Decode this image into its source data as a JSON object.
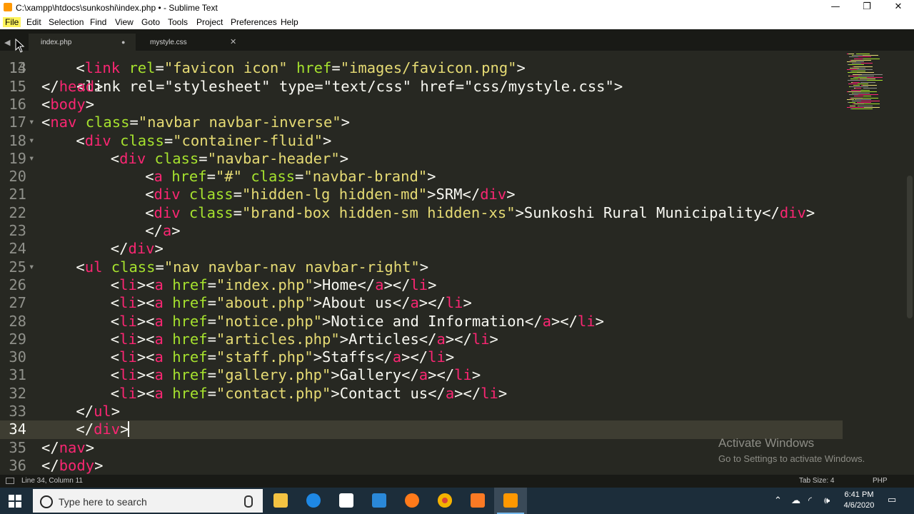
{
  "window": {
    "title": "C:\\xampp\\htdocs\\sunkoshi\\index.php • - Sublime Text",
    "minimize": "—",
    "restore": "❐",
    "close": "✕"
  },
  "menu": {
    "items": [
      "File",
      "Edit",
      "Selection",
      "Find",
      "View",
      "Goto",
      "Tools",
      "Project",
      "Preferences",
      "Help"
    ]
  },
  "tabs": [
    {
      "label": "index.php",
      "indicator": "●",
      "active": true
    },
    {
      "label": "mystyle.css",
      "indicator": "✕",
      "active": false
    }
  ],
  "editor": {
    "current_line": 34,
    "lines": [
      {
        "n": 13,
        "partial": true
      },
      {
        "n": 14,
        "fold": false
      },
      {
        "n": 15,
        "fold": false
      },
      {
        "n": 16,
        "fold": false
      },
      {
        "n": 17,
        "fold": true
      },
      {
        "n": 18,
        "fold": true
      },
      {
        "n": 19,
        "fold": true
      },
      {
        "n": 20,
        "fold": false
      },
      {
        "n": 21,
        "fold": false
      },
      {
        "n": 22,
        "fold": false
      },
      {
        "n": 23,
        "fold": false
      },
      {
        "n": 24,
        "fold": false
      },
      {
        "n": 25,
        "fold": true
      },
      {
        "n": 26,
        "fold": false
      },
      {
        "n": 27,
        "fold": false
      },
      {
        "n": 28,
        "fold": false
      },
      {
        "n": 29,
        "fold": false
      },
      {
        "n": 30,
        "fold": false
      },
      {
        "n": 31,
        "fold": false
      },
      {
        "n": 32,
        "fold": false
      },
      {
        "n": 33,
        "fold": false
      },
      {
        "n": 34,
        "fold": false
      },
      {
        "n": 35,
        "fold": false
      },
      {
        "n": 36,
        "fold": false
      }
    ],
    "code": {
      "l13": "<link rel=\"stylesheet\" type=\"text/css\" href=\"css/mystyle.css\">",
      "l14": [
        "<",
        "link",
        " ",
        "rel",
        "=",
        "\"favicon icon\"",
        " ",
        "href",
        "=",
        "\"images/favicon.png\"",
        ">"
      ],
      "l15": [
        "</",
        "head",
        ">"
      ],
      "l16": [
        "<",
        "body",
        ">"
      ],
      "l17": [
        "<",
        "nav",
        " ",
        "class",
        "=",
        "\"navbar navbar-inverse\"",
        ">"
      ],
      "l18": [
        "<",
        "div",
        " ",
        "class",
        "=",
        "\"container-fluid\"",
        ">"
      ],
      "l19": [
        "<",
        "div",
        " ",
        "class",
        "=",
        "\"navbar-header\"",
        ">"
      ],
      "l20": [
        "<",
        "a",
        " ",
        "href",
        "=",
        "\"#\"",
        " ",
        "class",
        "=",
        "\"navbar-brand\"",
        ">"
      ],
      "l21": [
        "<",
        "div",
        " ",
        "class",
        "=",
        "\"hidden-lg hidden-md\"",
        ">SRM</",
        "div",
        ">"
      ],
      "l22": [
        "<",
        "div",
        " ",
        "class",
        "=",
        "\"brand-box hidden-sm hidden-xs\"",
        ">Sunkoshi Rural Municipality</",
        "div",
        ">"
      ],
      "l23": [
        "</",
        "a",
        ">"
      ],
      "l24": [
        "</",
        "div",
        ">"
      ],
      "l25": [
        "<",
        "ul",
        " ",
        "class",
        "=",
        "\"nav navbar-nav navbar-right\"",
        ">"
      ],
      "l26": [
        "<",
        "li",
        "><",
        "a",
        " ",
        "href",
        "=",
        "\"index.php\"",
        ">Home</",
        "a",
        "></",
        "li",
        ">"
      ],
      "l27": [
        "<",
        "li",
        "><",
        "a",
        " ",
        "href",
        "=",
        "\"about.php\"",
        ">About us</",
        "a",
        "></",
        "li",
        ">"
      ],
      "l28": [
        "<",
        "li",
        "><",
        "a",
        " ",
        "href",
        "=",
        "\"notice.php\"",
        ">Notice and Information</",
        "a",
        "></",
        "li",
        ">"
      ],
      "l29": [
        "<",
        "li",
        "><",
        "a",
        " ",
        "href",
        "=",
        "\"articles.php\"",
        ">Articles</",
        "a",
        "></",
        "li",
        ">"
      ],
      "l30": [
        "<",
        "li",
        "><",
        "a",
        " ",
        "href",
        "=",
        "\"staff.php\"",
        ">Staffs</",
        "a",
        "></",
        "li",
        ">"
      ],
      "l31": [
        "<",
        "li",
        "><",
        "a",
        " ",
        "href",
        "=",
        "\"gallery.php\"",
        ">Gallery</",
        "a",
        "></",
        "li",
        ">"
      ],
      "l32": [
        "<",
        "li",
        "><",
        "a",
        " ",
        "href",
        "=",
        "\"contact.php\"",
        ">Contact us</",
        "a",
        "></",
        "li",
        ">"
      ],
      "l33": [
        "</",
        "ul",
        ">"
      ],
      "l34": [
        "</",
        "div",
        ">"
      ],
      "l35": [
        "</",
        "nav",
        ">"
      ],
      "l36": [
        "</",
        "body",
        ">"
      ]
    }
  },
  "watermark": {
    "title": "Activate Windows",
    "subtitle": "Go to Settings to activate Windows."
  },
  "statusbar": {
    "position": "Line 34, Column 11",
    "tab_size": "Tab Size: 4",
    "syntax": "PHP"
  },
  "taskbar": {
    "search_placeholder": "Type here to search",
    "apps": [
      "file-explorer-icon",
      "edge-icon",
      "store-icon",
      "mail-icon",
      "firefox-icon",
      "chrome-icon",
      "xampp-icon",
      "sublime-text-icon"
    ],
    "time": "6:41 PM",
    "date": "4/6/2020"
  },
  "colors": {
    "background": "#272822",
    "tag": "#f92672",
    "attribute": "#a6e22e",
    "string": "#e6db74",
    "text": "#f8f8f2",
    "gutter": "#8f908a",
    "taskbar": "#1c2d3a"
  }
}
